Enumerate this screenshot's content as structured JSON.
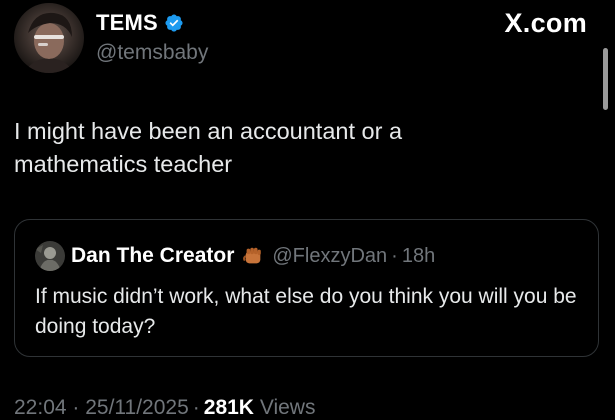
{
  "tweet": {
    "author": {
      "display_name": "TEMS",
      "handle": "@temsbaby",
      "verified_icon": "verified-badge-icon",
      "avatar_icon": "avatar-photo"
    },
    "text": "I might have been an accountant or a mathematics teacher",
    "timestamp": "22:04 · 25/11/2025",
    "views_count": "281K",
    "views_label": "Views"
  },
  "source": {
    "logo_text": "X.com"
  },
  "quoted_tweet": {
    "display_name": "Dan The Creator",
    "emoji_icon": "fist-emoji-icon",
    "handle": "@FlexzyDan",
    "separator": "·",
    "time": "18h",
    "text": "If music didn’t work, what else do you think you will you be doing today?"
  },
  "colors": {
    "background": "#000000",
    "primary_text": "#e7e9ea",
    "secondary_text": "#71767b",
    "verified_blue": "#1d9bf0",
    "card_border": "#2f3336"
  }
}
